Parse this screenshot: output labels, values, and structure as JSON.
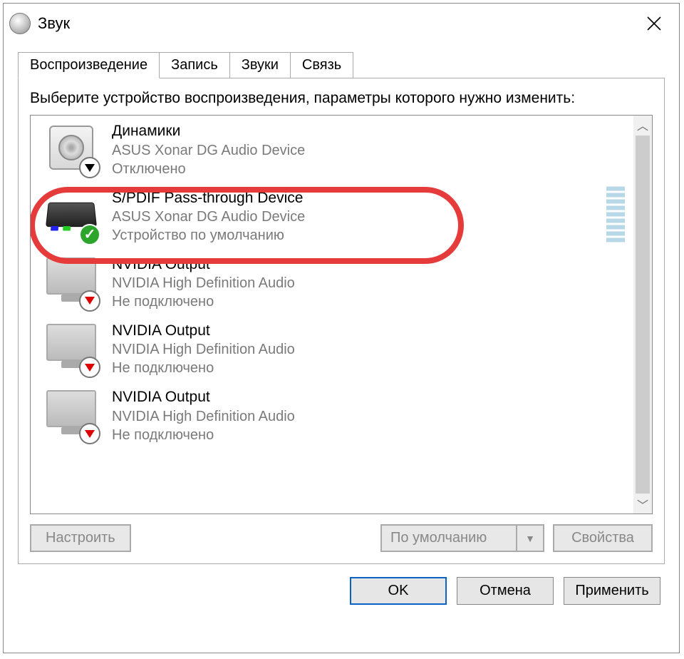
{
  "window": {
    "title": "Звук"
  },
  "tabs": [
    {
      "label": "Воспроизведение",
      "active": true
    },
    {
      "label": "Запись",
      "active": false
    },
    {
      "label": "Звуки",
      "active": false
    },
    {
      "label": "Связь",
      "active": false
    }
  ],
  "instruction": "Выберите устройство воспроизведения, параметры которого нужно изменить:",
  "devices": [
    {
      "name": "Динамики",
      "desc": "ASUS Xonar DG Audio Device",
      "status": "Отключено",
      "icon": "speaker",
      "overlay": "down-black",
      "meter": false,
      "selected": false,
      "highlighted": false
    },
    {
      "name": "S/PDIF Pass-through Device",
      "desc": "ASUS Xonar DG Audio Device",
      "status": "Устройство по умолчанию",
      "icon": "spdif",
      "overlay": "check-green",
      "meter": true,
      "selected": false,
      "highlighted": true
    },
    {
      "name": "NVIDIA Output",
      "desc": "NVIDIA High Definition Audio",
      "status": "Не подключено",
      "icon": "monitor",
      "overlay": "down-red",
      "meter": false,
      "selected": false,
      "highlighted": false
    },
    {
      "name": "NVIDIA Output",
      "desc": "NVIDIA High Definition Audio",
      "status": "Не подключено",
      "icon": "monitor",
      "overlay": "down-red",
      "meter": false,
      "selected": false,
      "highlighted": false
    },
    {
      "name": "NVIDIA Output",
      "desc": "NVIDIA High Definition Audio",
      "status": "Не подключено",
      "icon": "monitor",
      "overlay": "down-red",
      "meter": false,
      "selected": false,
      "highlighted": false
    }
  ],
  "panel_buttons": {
    "configure": "Настроить",
    "set_default": "По умолчанию",
    "properties": "Свойства"
  },
  "dialog_buttons": {
    "ok": "OK",
    "cancel": "Отмена",
    "apply": "Применить"
  }
}
